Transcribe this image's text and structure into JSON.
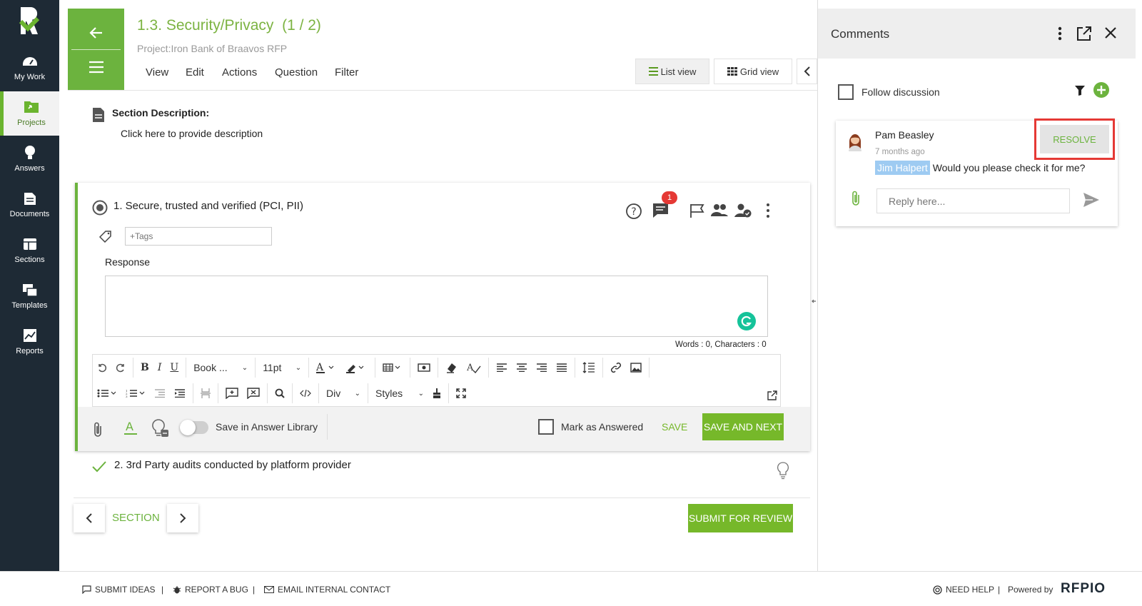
{
  "sidebar": {
    "items": [
      {
        "label": "My Work",
        "icon": "dashboard-icon"
      },
      {
        "label": "Projects",
        "icon": "folder-icon"
      },
      {
        "label": "Answers",
        "icon": "lightbulb-icon"
      },
      {
        "label": "Documents",
        "icon": "document-icon"
      },
      {
        "label": "Sections",
        "icon": "sections-icon"
      },
      {
        "label": "Templates",
        "icon": "templates-icon"
      },
      {
        "label": "Reports",
        "icon": "reports-icon"
      }
    ],
    "active": "Projects"
  },
  "header": {
    "title": "1.3. Security/Privacy",
    "count": "(1 / 2)",
    "subtitle": "Project:Iron Bank of Braavos RFP",
    "menu": [
      "View",
      "Edit",
      "Actions",
      "Question",
      "Filter"
    ],
    "list_view": "List view",
    "grid_view": "Grid view"
  },
  "section": {
    "label": "Section Description:",
    "placeholder": "Click here to provide description"
  },
  "question1": {
    "title": "1. Secure, trusted and verified (PCI, PII)",
    "comment_badge": "1",
    "tags_placeholder": "+Tags",
    "response_label": "Response",
    "word_count": "Words : 0, Characters : 0"
  },
  "editor": {
    "font": "Book ...",
    "size": "11pt",
    "block": "Div",
    "styles": "Styles"
  },
  "card_footer": {
    "save_library": "Save in Answer Library",
    "mark_answered": "Mark as Answered",
    "save": "SAVE",
    "save_next": "SAVE AND NEXT"
  },
  "question2": {
    "title": "2. 3rd Party audits conducted by platform provider"
  },
  "bottom_nav": {
    "section": "SECTION",
    "submit": "SUBMIT FOR REVIEW"
  },
  "comments": {
    "title": "Comments",
    "follow": "Follow discussion",
    "author": "Pam Beasley",
    "time": "7 months ago",
    "mention": "Jim Halpert",
    "text": "Would you please check it for me?",
    "resolve": "RESOLVE",
    "reply_placeholder": "Reply here..."
  },
  "footer": {
    "submit_ideas": "SUBMIT IDEAS",
    "report_bug": "REPORT A BUG",
    "email_contact": "EMAIL INTERNAL CONTACT",
    "need_help": "NEED HELP",
    "powered_by": "Powered by",
    "brand": "RFPIO"
  },
  "colors": {
    "accent": "#6cb33e",
    "sidebar": "#1e2a35",
    "highlight": "#e53935",
    "mention_bg": "#9ecbf2"
  }
}
